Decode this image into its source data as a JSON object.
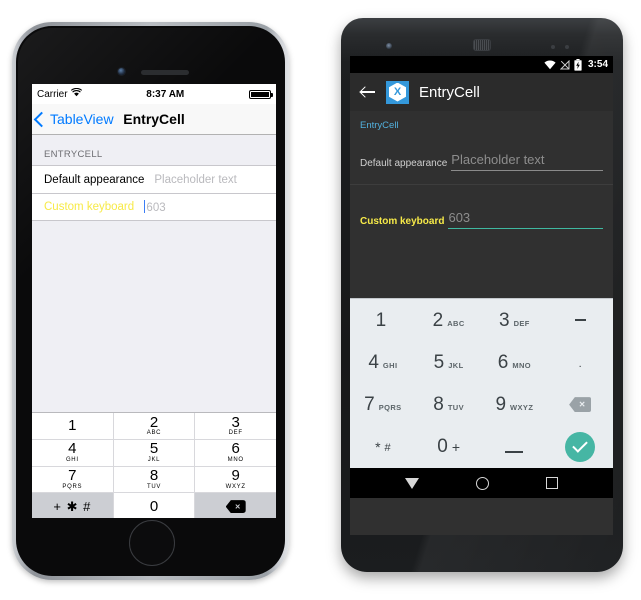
{
  "ios": {
    "status_bar": {
      "carrier": "Carrier",
      "wifi_icon": "wifi-icon",
      "time": "8:37 AM",
      "battery_icon": "battery-full-icon"
    },
    "nav_bar": {
      "back_label": "TableView",
      "back_icon": "chevron-left-icon",
      "title": "EntryCell"
    },
    "table": {
      "section_header": "ENTRYCELL",
      "rows": [
        {
          "label": "Default appearance",
          "value": "Placeholder text",
          "placeholder": "Placeholder text",
          "is_placeholder": true,
          "highlight": false
        },
        {
          "label": "Custom keyboard",
          "value": "603",
          "placeholder": "",
          "is_placeholder": false,
          "highlight": true
        }
      ]
    },
    "keyboard": {
      "rows": [
        [
          {
            "num": "1",
            "sub": ""
          },
          {
            "num": "2",
            "sub": "ABC"
          },
          {
            "num": "3",
            "sub": "DEF"
          }
        ],
        [
          {
            "num": "4",
            "sub": "GHI"
          },
          {
            "num": "5",
            "sub": "JKL"
          },
          {
            "num": "6",
            "sub": "MNO"
          }
        ],
        [
          {
            "num": "7",
            "sub": "PQRS"
          },
          {
            "num": "8",
            "sub": "TUV"
          },
          {
            "num": "9",
            "sub": "WXYZ"
          }
        ]
      ],
      "bottom": {
        "symbols_label": "+ ✱ #",
        "zero": "0",
        "delete_icon": "backspace-icon",
        "delete_glyph": "✕"
      }
    }
  },
  "android": {
    "status_bar": {
      "wifi_icon": "wifi-icon",
      "signal_icon": "signal-no-service-icon",
      "battery_icon": "battery-charging-icon",
      "time": "3:54"
    },
    "app_bar": {
      "back_icon": "arrow-left-icon",
      "app_logo": "xamarin-logo-icon",
      "app_logo_letter": "X",
      "title": "EntryCell"
    },
    "content": {
      "section_header": "EntryCell",
      "rows": [
        {
          "label": "Default appearance",
          "value": "Placeholder text",
          "is_placeholder": true,
          "highlight": false,
          "focused": false
        },
        {
          "label": "Custom keyboard",
          "value": "603",
          "is_placeholder": false,
          "highlight": true,
          "focused": true
        }
      ]
    },
    "keyboard": {
      "rows": [
        [
          {
            "num": "1",
            "sub": ""
          },
          {
            "num": "2",
            "sub": "ABC"
          },
          {
            "num": "3",
            "sub": "DEF"
          },
          {
            "num": "",
            "sub": "",
            "special": "dash"
          }
        ],
        [
          {
            "num": "4",
            "sub": "GHI"
          },
          {
            "num": "5",
            "sub": "JKL"
          },
          {
            "num": "6",
            "sub": "MNO"
          },
          {
            "num": ".",
            "sub": "",
            "special": ""
          }
        ],
        [
          {
            "num": "7",
            "sub": "PQRS"
          },
          {
            "num": "8",
            "sub": "TUV"
          },
          {
            "num": "9",
            "sub": "WXYZ"
          },
          {
            "num": "",
            "sub": "",
            "special": "delete"
          }
        ],
        [
          {
            "num": "*",
            "sub": "#",
            "special": "starhash"
          },
          {
            "num": "0",
            "sub": "+",
            "special": "zeroplus"
          },
          {
            "num": "",
            "sub": "",
            "special": "space"
          },
          {
            "num": "",
            "sub": "",
            "special": "enter"
          }
        ]
      ],
      "delete_icon": "backspace-icon",
      "delete_glyph": "✕",
      "enter_icon": "check-icon"
    },
    "nav_bar": {
      "back_icon": "nav-back-triangle-icon",
      "home_icon": "nav-home-circle-icon",
      "recents_icon": "nav-recents-square-icon"
    }
  },
  "colors": {
    "ios_tint": "#007aff",
    "ios_highlight": "#f7ea48",
    "android_accent": "#52b0dd",
    "android_highlight": "#f7ea48",
    "android_field_focus": "#3fb8a0",
    "xamarin_blue": "#3498db",
    "android_enter": "#46b6a4"
  }
}
